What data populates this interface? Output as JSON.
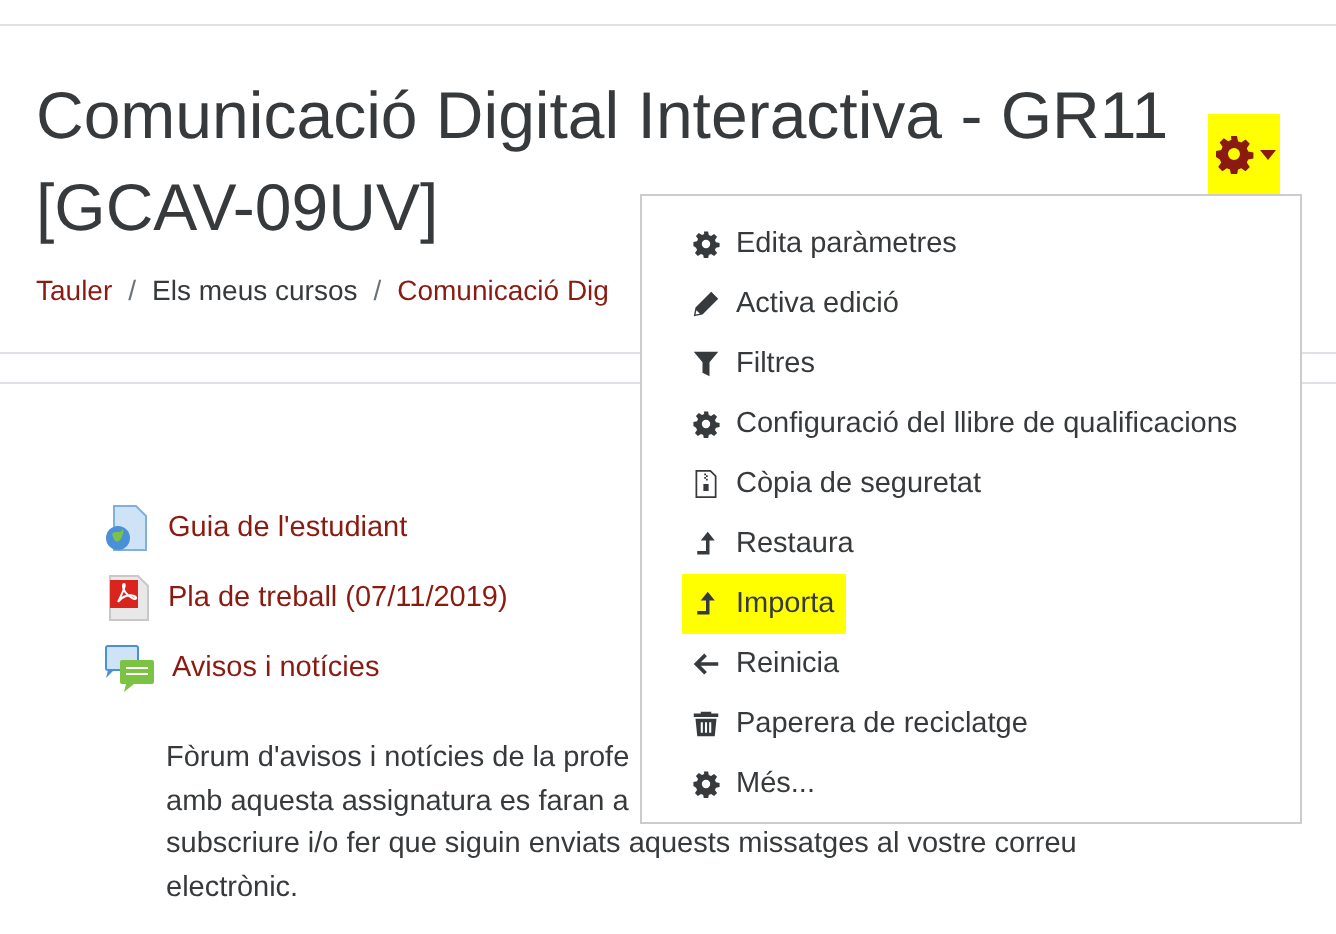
{
  "page_title": [
    "Comunicació Digital Interactiva - GR11",
    "[GCAV-09UV]"
  ],
  "settings_button": {
    "highlighted": true
  },
  "breadcrumb": [
    {
      "label": "Tauler",
      "link": true
    },
    {
      "separator": "/",
      "label": "Els meus cursos",
      "link": false
    },
    {
      "separator": "/",
      "label": "Comunicació Dig",
      "link": true
    }
  ],
  "activities": [
    {
      "kind": "page",
      "label": "Guia de l'estudiant"
    },
    {
      "kind": "pdf",
      "label": "Pla de treball (07/11/2019)"
    },
    {
      "kind": "forum",
      "label": "Avisos i notícies"
    }
  ],
  "forum_description": [
    "Fòrum d'avisos i notícies de la profe",
    "amb aquesta assignatura es faran a",
    "subscriure i/o fer que siguin enviats aquests missatges al vostre correu",
    "electrònic."
  ],
  "menu": [
    {
      "kind": "gear",
      "label": "Edita paràmetres",
      "highlighted": false
    },
    {
      "kind": "pencil",
      "label": "Activa edició",
      "highlighted": false
    },
    {
      "kind": "filter",
      "label": "Filtres",
      "highlighted": false
    },
    {
      "kind": "gear",
      "label": "Configuració del llibre de qualificacions",
      "highlighted": false
    },
    {
      "kind": "archive",
      "label": "Còpia de seguretat",
      "highlighted": false
    },
    {
      "kind": "upload",
      "label": "Restaura",
      "highlighted": false
    },
    {
      "kind": "upload",
      "label": "Importa",
      "highlighted": true
    },
    {
      "kind": "back",
      "label": "Reinicia",
      "highlighted": false
    },
    {
      "kind": "trash",
      "label": "Paperera de reciclatge",
      "highlighted": false
    },
    {
      "kind": "gear",
      "label": "Més...",
      "highlighted": false
    }
  ]
}
